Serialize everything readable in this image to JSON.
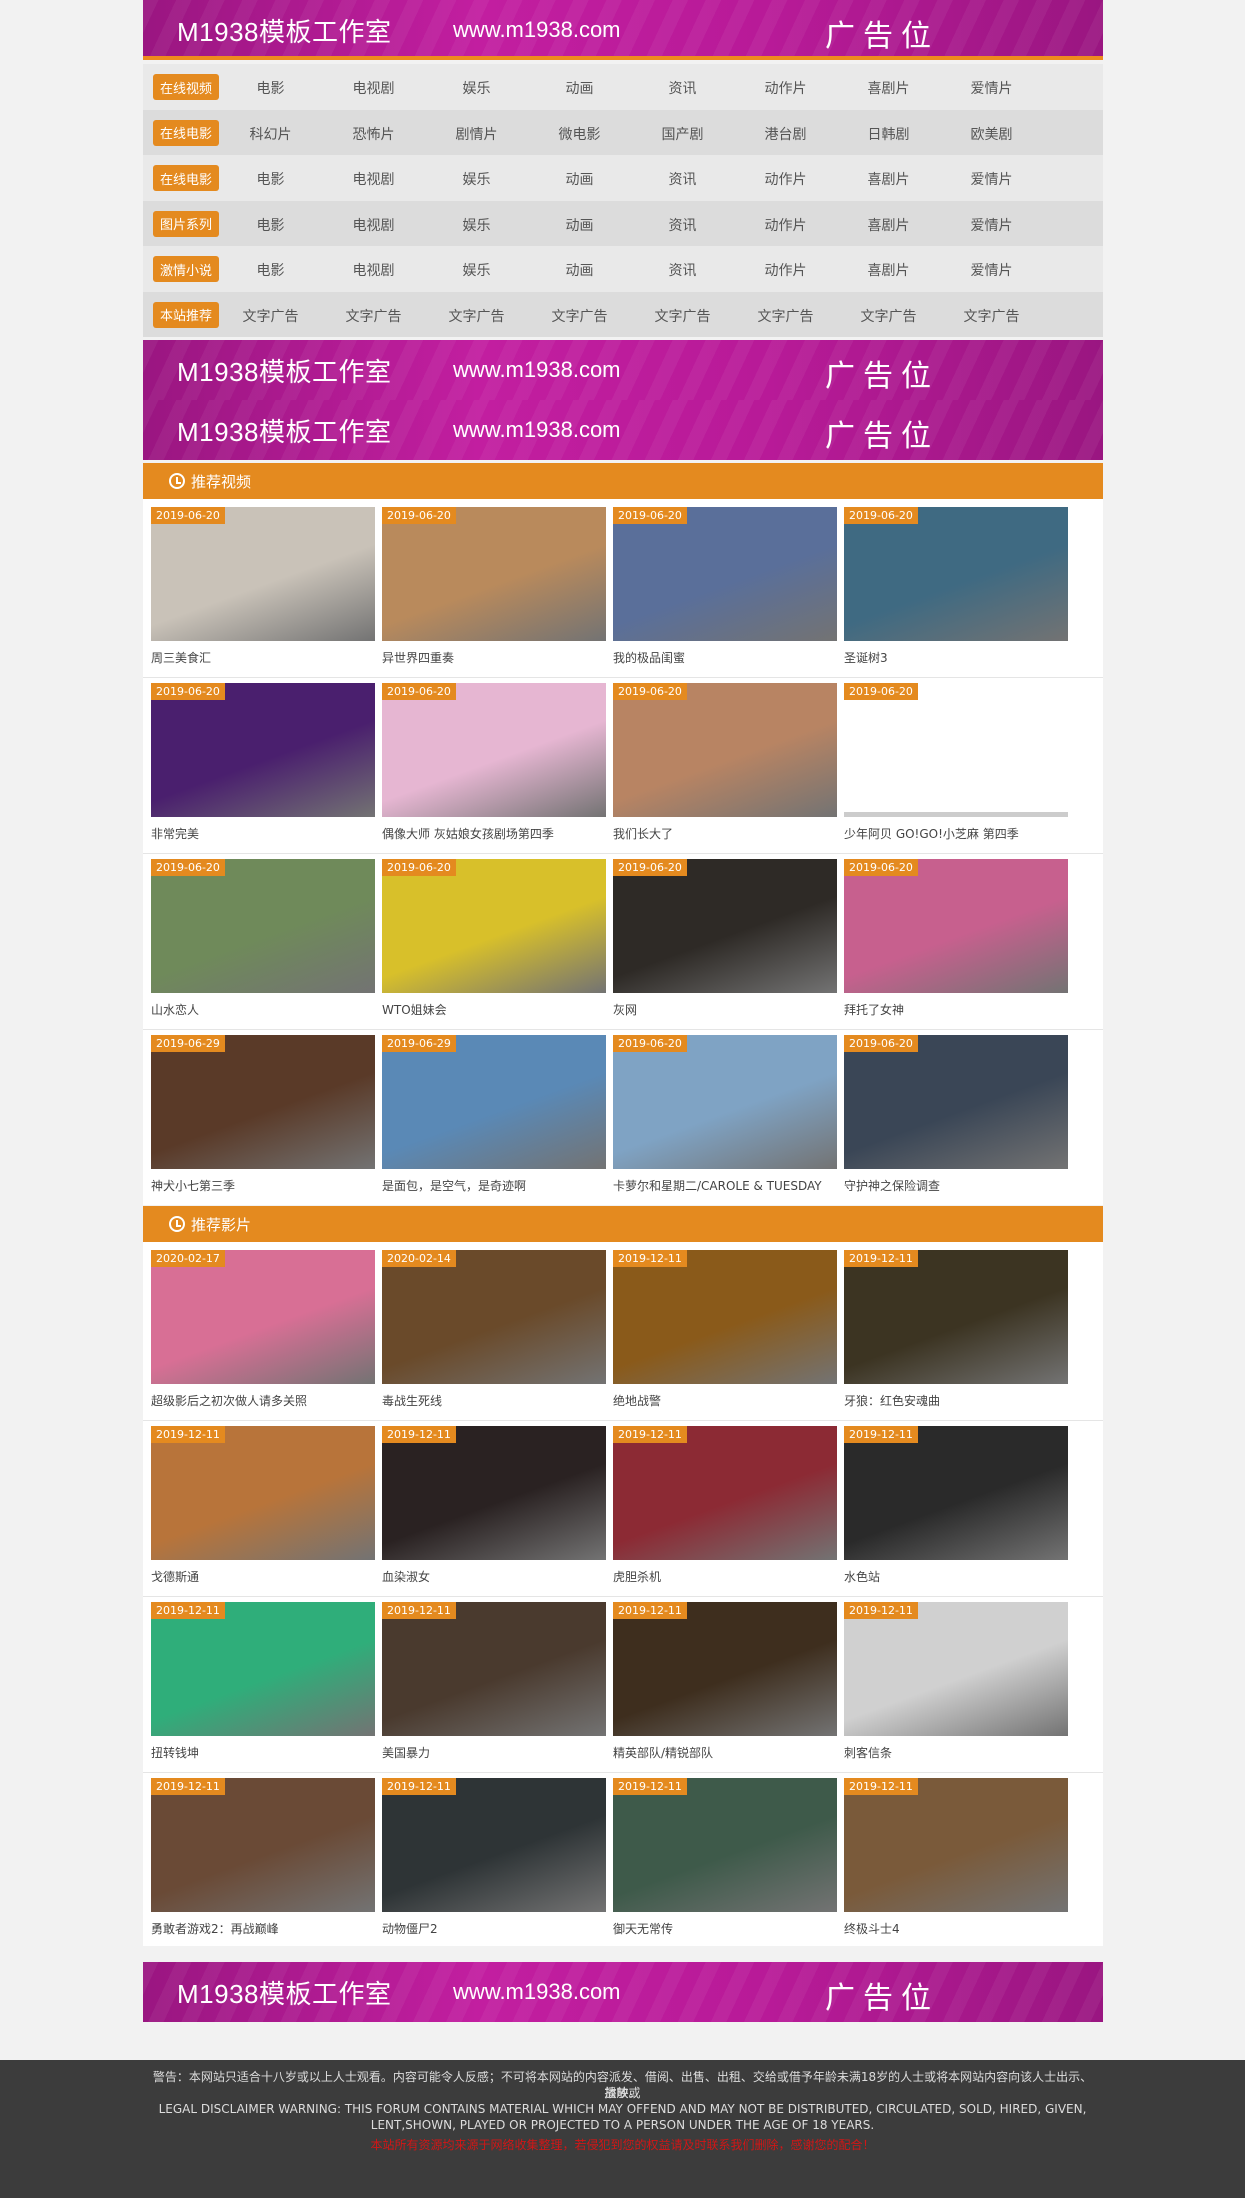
{
  "banners": {
    "brand": "M1938模板工作室",
    "url": "www.m1938.com",
    "ad": "广告位"
  },
  "nav": {
    "rows": [
      {
        "category": "在线视频",
        "links": [
          "电影",
          "电视剧",
          "娱乐",
          "动画",
          "资讯",
          "动作片",
          "喜剧片",
          "爱情片"
        ]
      },
      {
        "category": "在线电影",
        "links": [
          "科幻片",
          "恐怖片",
          "剧情片",
          "微电影",
          "国产剧",
          "港台剧",
          "日韩剧",
          "欧美剧"
        ]
      },
      {
        "category": "在线电影",
        "links": [
          "电影",
          "电视剧",
          "娱乐",
          "动画",
          "资讯",
          "动作片",
          "喜剧片",
          "爱情片"
        ]
      },
      {
        "category": "图片系列",
        "links": [
          "电影",
          "电视剧",
          "娱乐",
          "动画",
          "资讯",
          "动作片",
          "喜剧片",
          "爱情片"
        ]
      },
      {
        "category": "激情小说",
        "links": [
          "电影",
          "电视剧",
          "娱乐",
          "动画",
          "资讯",
          "动作片",
          "喜剧片",
          "爱情片"
        ]
      },
      {
        "category": "本站推荐",
        "links": [
          "文字广告",
          "文字广告",
          "文字广告",
          "文字广告",
          "文字广告",
          "文字广告",
          "文字广告",
          "文字广告"
        ]
      }
    ]
  },
  "section_videos": {
    "title": "推荐视频",
    "items": [
      {
        "date": "2019-06-20",
        "title": "周三美食汇",
        "bg": "#c9c2b8"
      },
      {
        "date": "2019-06-20",
        "title": "异世界四重奏",
        "bg": "#b98a5c"
      },
      {
        "date": "2019-06-20",
        "title": "我的极品闺蜜",
        "bg": "#5a6f9a"
      },
      {
        "date": "2019-06-20",
        "title": "圣诞树3",
        "bg": "#3f6a82"
      },
      {
        "date": "2019-06-20",
        "title": "非常完美",
        "bg": "#4a1f6e"
      },
      {
        "date": "2019-06-20",
        "title": "偶像大师 灰姑娘女孩剧场第四季",
        "bg": "#e6b6d2"
      },
      {
        "date": "2019-06-20",
        "title": "我们长大了",
        "bg": "#b88463"
      },
      {
        "date": "2019-06-20",
        "title": "少年阿贝 GO!GO!小芝麻 第四季",
        "bg": ""
      },
      {
        "date": "2019-06-20",
        "title": "山水恋人",
        "bg": "#6f8a5a"
      },
      {
        "date": "2019-06-20",
        "title": "WTO姐妹会",
        "bg": "#d8c02a"
      },
      {
        "date": "2019-06-20",
        "title": "灰网",
        "bg": "#2e2a26"
      },
      {
        "date": "2019-06-20",
        "title": "拜托了女神",
        "bg": "#c7608e"
      },
      {
        "date": "2019-06-29",
        "title": "神犬小七第三季",
        "bg": "#5a3a28"
      },
      {
        "date": "2019-06-29",
        "title": "是面包，是空气，是奇迹啊",
        "bg": "#5a89b6"
      },
      {
        "date": "2019-06-20",
        "title": "卡萝尔和星期二/CAROLE & TUESDAY",
        "bg": "#7fa3c4"
      },
      {
        "date": "2019-06-20",
        "title": "守护神之保险调查",
        "bg": "#3a4656"
      }
    ]
  },
  "section_films": {
    "title": "推荐影片",
    "items": [
      {
        "date": "2020-02-17",
        "title": "超级影后之初次做人请多关照",
        "bg": "#d86f95"
      },
      {
        "date": "2020-02-14",
        "title": "毒战生死线",
        "bg": "#6a4a2a"
      },
      {
        "date": "2019-12-11",
        "title": "绝地战警",
        "bg": "#8a5a1a"
      },
      {
        "date": "2019-12-11",
        "title": "牙狼：红色安魂曲",
        "bg": "#3c3422"
      },
      {
        "date": "2019-12-11",
        "title": "戈德斯通",
        "bg": "#b8743a"
      },
      {
        "date": "2019-12-11",
        "title": "血染淑女",
        "bg": "#2a2222"
      },
      {
        "date": "2019-12-11",
        "title": "虎胆杀机",
        "bg": "#8c2a34"
      },
      {
        "date": "2019-12-11",
        "title": "水色站",
        "bg": "#2a2a2a"
      },
      {
        "date": "2019-12-11",
        "title": "扭转钱坤",
        "bg": "#2fae7a"
      },
      {
        "date": "2019-12-11",
        "title": "美国暴力",
        "bg": "#4a3a2e"
      },
      {
        "date": "2019-12-11",
        "title": "精英部队/精锐部队",
        "bg": "#3e2e1e"
      },
      {
        "date": "2019-12-11",
        "title": "刺客信条",
        "bg": "#d0d0d0"
      },
      {
        "date": "2019-12-11",
        "title": "勇敢者游戏2：再战巅峰",
        "bg": "#6a4a36"
      },
      {
        "date": "2019-12-11",
        "title": "动物僵尸2",
        "bg": "#2e3436"
      },
      {
        "date": "2019-12-11",
        "title": "御天无常传",
        "bg": "#3e5a4a"
      },
      {
        "date": "2019-12-11",
        "title": "终极斗士4",
        "bg": "#7a5a3a"
      }
    ]
  },
  "footer": {
    "line1": "警告：本网站只适合十八岁或以上人士观看。内容可能令人反感；不可将本网站的内容派发、借阅、出售、出租、交给或借予年龄未满18岁的人士或将本网站内容向该人士出示、播放或",
    "line2": "放映。",
    "line3": "LEGAL DISCLAIMER WARNING: THIS FORUM CONTAINS MATERIAL WHICH MAY OFFEND AND MAY NOT BE DISTRIBUTED, CIRCULATED, SOLD, HIRED, GIVEN,",
    "line4": "LENT,SHOWN, PLAYED OR PROJECTED TO A PERSON UNDER THE AGE OF 18 YEARS.",
    "line5": "本站所有资源均来源于网络收集整理，若侵犯到您的权益请及时联系我们删除，感谢您的配合！"
  }
}
